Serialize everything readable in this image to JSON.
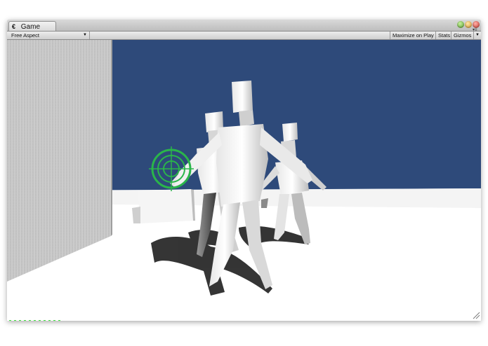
{
  "window": {
    "tab_title": "Game",
    "tab_icon": "unity-logo-icon"
  },
  "toolbar": {
    "aspect_label": "Free Aspect",
    "maximize_label": "Maximize on Play",
    "stats_label": "Stats",
    "gizmos_label": "Gizmos"
  },
  "hud": {
    "ammo_count": 11,
    "ammo_color": "#3fe63f",
    "crosshair_color": "#2ab54a"
  },
  "scene": {
    "sky_color": "#2e4a7a",
    "ground_color": "#ffffff",
    "wall_color": "#c7c7c7",
    "figures": 3
  },
  "colors": {
    "traffic_close": "#c8382e",
    "traffic_minimize": "#d3942b",
    "traffic_zoom": "#58a42c"
  }
}
